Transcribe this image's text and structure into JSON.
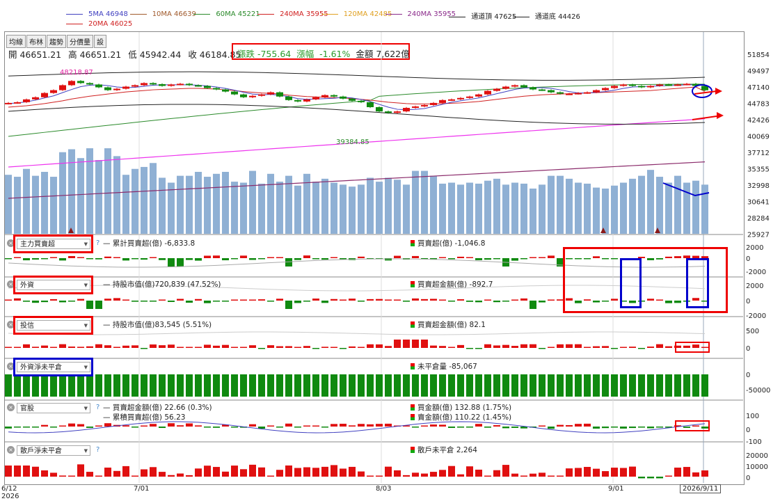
{
  "legend": [
    {
      "label": "5MA 46948",
      "color": "#4040c0"
    },
    {
      "label": "10MA 46639",
      "color": "#a05a2c"
    },
    {
      "label": "60MA 45221",
      "color": "#2a8a2a"
    },
    {
      "label": "240MA 35955",
      "color": "#d02020"
    },
    {
      "label": "120MA 42485",
      "color": "#e0a020"
    },
    {
      "label": "240MA 35955",
      "color": "#8a2a8a"
    },
    {
      "label": "通道頂 47625",
      "color": "#222222"
    },
    {
      "label": "通道底 44426",
      "color": "#222222"
    },
    {
      "label": "20MA 46025",
      "color": "#d02020"
    }
  ],
  "tabs": [
    "均線",
    "布林",
    "趨勢",
    "分價量",
    "設"
  ],
  "ohlc": {
    "open": "開 46651.21",
    "high": "高 46651.21",
    "low": "低 45942.44",
    "close": "收 46184.85"
  },
  "change": {
    "chg": "漲跌 -755.64",
    "pct_label": "漲幅",
    "pct": "-1.61%",
    "amount": "金額 7,622億"
  },
  "annotations": {
    "high": "48218.87",
    "low": "39384.85"
  },
  "price_axis": [
    "51854",
    "49497",
    "47140",
    "44783",
    "42426",
    "40069",
    "37712",
    "35355",
    "32998",
    "30641",
    "28284",
    "25927"
  ],
  "panels": [
    {
      "select": "主力買賣超",
      "left": "累計買賣超(億) -6,833.8",
      "right": "買賣超(億) -1,046.8",
      "y": [
        "2000",
        "0",
        "-2000"
      ]
    },
    {
      "select": "外資",
      "left": "持股市值(億)720,839 (47.52%)",
      "right": "買賣超金額(億) -892.7",
      "y": [
        "2000",
        "0",
        "-2000"
      ]
    },
    {
      "select": "投信",
      "left": "持股市值(億)83,545 (5.51%)",
      "right": "買賣超金額(億) 82.1",
      "y": [
        "500",
        "0"
      ]
    },
    {
      "select": "外資淨未平倉",
      "left": "",
      "right": "未平倉量 -85,067",
      "y": [
        "0",
        "-50000"
      ]
    },
    {
      "select": "官股",
      "left": "買賣超金額(億) 22.66 (0.3%)",
      "left2": "累積買賣超(億) 56.23",
      "right": "買金額(億) 132.88 (1.75%)",
      "right2": "賣金額(億) 110.22 (1.45%)",
      "y": [
        "100",
        "0",
        "-100"
      ]
    },
    {
      "select": "散戶淨未平倉",
      "left": "",
      "right": "散戶未平倉 2,264",
      "y": [
        "20000",
        "10000",
        "0"
      ]
    }
  ],
  "x_axis": {
    "labels": [
      "6/12",
      "7/01",
      "8/03",
      "9/01"
    ],
    "year": "2026",
    "current": "2026/9/11"
  },
  "chart_data": {
    "type": "candlestick",
    "close": [
      44400,
      44500,
      44900,
      45200,
      45800,
      46200,
      46900,
      47500,
      47200,
      47000,
      46600,
      46200,
      46400,
      46700,
      46900,
      47200,
      47050,
      46800,
      47000,
      47100,
      46900,
      46800,
      46500,
      46300,
      46000,
      45600,
      45200,
      45400,
      45600,
      45900,
      45300,
      44800,
      44600,
      44900,
      45200,
      45500,
      45300,
      45000,
      44700,
      44500,
      43800,
      43200,
      43000,
      43200,
      43700,
      43900,
      44100,
      44400,
      44800,
      44900,
      45100,
      45300,
      45600,
      46100,
      46400,
      46700,
      46900,
      46600,
      46300,
      46200,
      45900,
      45700,
      45700,
      45800,
      45900,
      46200,
      46500,
      46800,
      47000,
      46800,
      46600,
      46800,
      47000,
      46900,
      47000,
      47100,
      46800,
      46185
    ],
    "volume": [
      3000,
      2900,
      3300,
      2950,
      3150,
      2900,
      4150,
      4300,
      3850,
      4350,
      3750,
      4350,
      3950,
      3000,
      3300,
      3400,
      3600,
      2850,
      2600,
      2950,
      2950,
      3150,
      2900,
      3050,
      3150,
      2650,
      2600,
      3200,
      2550,
      3050,
      2650,
      2950,
      2450,
      3050,
      2650,
      2800,
      2600,
      2500,
      2400,
      2500,
      2850,
      2650,
      2850,
      2750,
      2500,
      3200,
      3200,
      2950,
      2550,
      2600,
      2500,
      2600,
      2550,
      2700,
      2800,
      2500,
      2600,
      2550,
      2300,
      2500,
      2950,
      2950,
      2800,
      2600,
      2550,
      2350,
      2300,
      2450,
      2600,
      2800,
      2950,
      3250,
      2900,
      2600,
      2950,
      2600,
      2700,
      2500
    ],
    "ma5": [
      44300,
      44400,
      44550,
      44800,
      45100,
      45400,
      45850,
      46300,
      46700,
      46900,
      46950,
      46850,
      46650,
      46550,
      46600,
      46750,
      46900,
      46950,
      46950,
      46950,
      46950,
      46900,
      46800,
      46650,
      46450,
      46200,
      45900,
      45650,
      45550,
      45600,
      45500,
      45300,
      45000,
      44900,
      44950,
      45000,
      45050,
      45200,
      45100,
      44900,
      44600,
      44200,
      43800,
      43500,
      43450,
      43500,
      43600,
      43900,
      44200,
      44500,
      44700,
      44900,
      45100,
      45400,
      45700,
      46000,
      46300,
      46500,
      46550,
      46550,
      46450,
      46250,
      46000,
      45800,
      45800,
      45900,
      46000,
      46200,
      46450,
      46650,
      46700,
      46750,
      46800,
      46850,
      46900,
      46950,
      46950,
      46948
    ],
    "ma20": [
      43800,
      43900,
      44000,
      44150,
      44300,
      44500,
      44700,
      44950,
      45150,
      45350,
      45500,
      45650,
      45800,
      45950,
      46050,
      46150,
      46250,
      46300,
      46350,
      46400,
      46450,
      46450,
      46400,
      46350,
      46250,
      46150,
      46000,
      45900,
      45800,
      45750,
      45650,
      45500,
      45400,
      45300,
      45250,
      45200,
      45150,
      45100,
      45000,
      44900,
      44800,
      44650,
      44500,
      44400,
      44300,
      44250,
      44250,
      44250,
      44300,
      44350,
      44400,
      44500,
      44600,
      44750,
      44900,
      45050,
      45200,
      45350,
      45450,
      45550,
      45600,
      45650,
      45700,
      45750,
      45800,
      45850,
      45900,
      45950,
      46000,
      46050,
      46100,
      46150,
      46250,
      46350,
      46450,
      46550,
      46650,
      46025
    ]
  }
}
